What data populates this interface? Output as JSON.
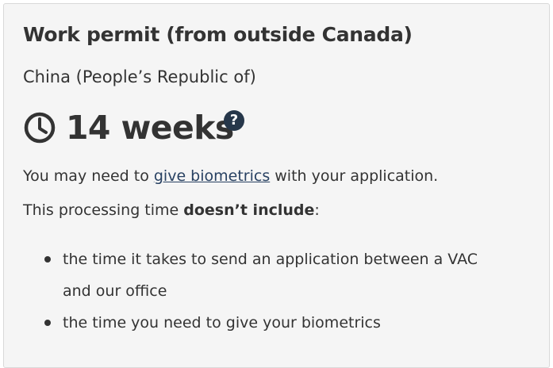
{
  "card": {
    "title": "Work permit (from outside Canada)",
    "country": "China (People’s Republic of)",
    "processing_time": "14 weeks",
    "help_icon": "question-circle-icon",
    "clock_icon": "clock-icon",
    "biometrics_sentence": {
      "before": "You may need to ",
      "link": "give biometrics",
      "after": " with your application."
    },
    "exclusion_sentence": {
      "before": "This processing time ",
      "bold": "doesn’t include",
      "after": ":"
    },
    "excluded_items": [
      "the time it takes to send an application between a VAC and our office",
      "the time you need to give your biometrics"
    ]
  },
  "colors": {
    "text": "#333333",
    "link": "#284162",
    "help_badge": "#26374a",
    "card_background": "#f5f5f5",
    "card_border": "#d9d9d9"
  }
}
